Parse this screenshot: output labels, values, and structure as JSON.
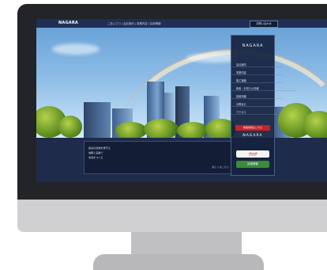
{
  "site": {
    "logo": "NAGARA",
    "nav_text": "ごあいさつ  |  会社案内  |  事業内容  |  採用情報",
    "contact_label": "お問い合わせ"
  },
  "sidebar": {
    "brand": "NAGARA",
    "items": [
      "会社案内",
      "事業内容",
      "施工実績",
      "新着・お知らせ情報",
      "採用情報",
      "お問合せ",
      "アクセス"
    ],
    "red_button": "新着情報はこちら",
    "brand2": "NAGARA",
    "blog": "ブログ",
    "green_button": "採用情報"
  },
  "notice": {
    "lines": [
      "長良の建物を見守る",
      "信頼と実績で",
      "未来をつくる"
    ],
    "link": "詳しくはこちら"
  },
  "colors": {
    "accent_red": "#c4232b",
    "navy": "#1e2b4b"
  }
}
